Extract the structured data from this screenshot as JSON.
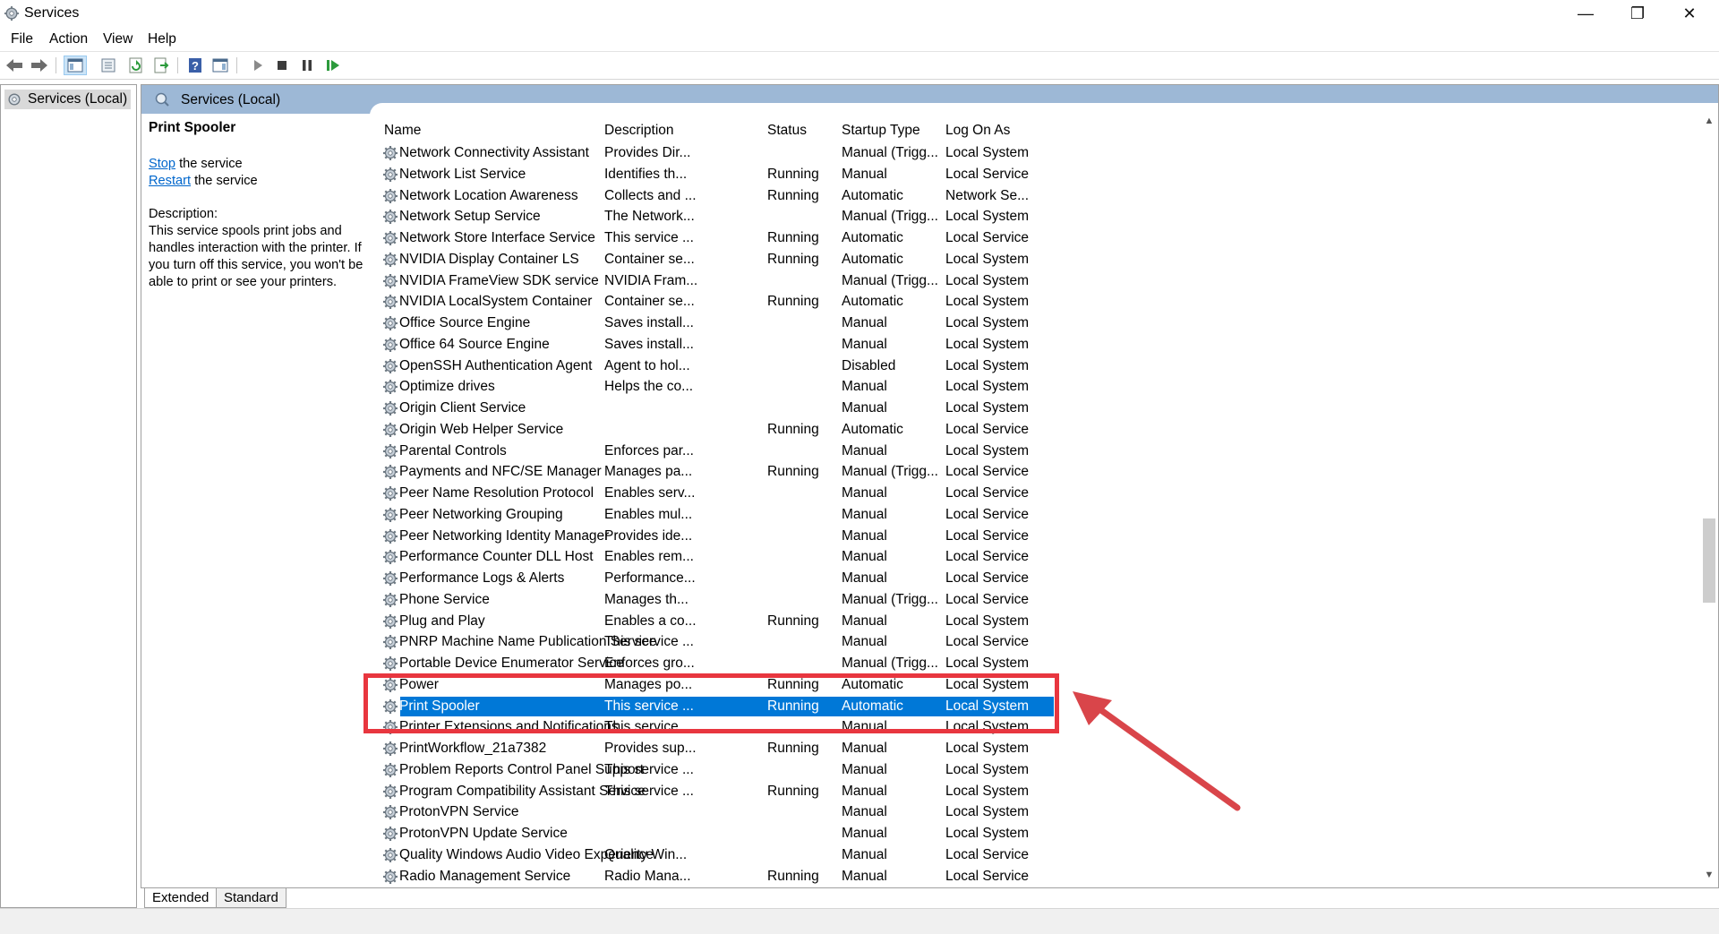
{
  "window": {
    "title": "Services",
    "controls": {
      "minimize": "—",
      "maximize": "❐",
      "close": "✕"
    }
  },
  "menu": [
    "File",
    "Action",
    "View",
    "Help"
  ],
  "toolbar": {
    "icons": [
      "back-icon",
      "forward-icon",
      "show-hide-console-tree-icon",
      "properties-icon",
      "refresh-icon",
      "export-list-icon",
      "help-icon",
      "show-action-pane-icon",
      "start-service-icon",
      "stop-service-icon",
      "pause-service-icon",
      "resume-service-icon"
    ]
  },
  "tree": {
    "root_label": "Services (Local)"
  },
  "panel": {
    "header_title": "Services (Local)"
  },
  "details": {
    "service_name": "Print Spooler",
    "stop_link": "Stop",
    "stop_suffix": " the service",
    "restart_link": "Restart",
    "restart_suffix": " the service",
    "description_label": "Description:",
    "description_text": "This service spools print jobs and handles interaction with the printer. If you turn off this service, you won't be able to print or see your printers."
  },
  "columns": [
    "Name",
    "Description",
    "Status",
    "Startup Type",
    "Log On As"
  ],
  "rows": [
    {
      "name": "Network Connectivity Assistant",
      "description": "Provides Dir...",
      "status": "",
      "startup": "Manual (Trigg...",
      "logon": "Local System"
    },
    {
      "name": "Network List Service",
      "description": "Identifies th...",
      "status": "Running",
      "startup": "Manual",
      "logon": "Local Service"
    },
    {
      "name": "Network Location Awareness",
      "description": "Collects and ...",
      "status": "Running",
      "startup": "Automatic",
      "logon": "Network Se..."
    },
    {
      "name": "Network Setup Service",
      "description": "The Network...",
      "status": "",
      "startup": "Manual (Trigg...",
      "logon": "Local System"
    },
    {
      "name": "Network Store Interface Service",
      "description": "This service ...",
      "status": "Running",
      "startup": "Automatic",
      "logon": "Local Service"
    },
    {
      "name": "NVIDIA Display Container LS",
      "description": "Container se...",
      "status": "Running",
      "startup": "Automatic",
      "logon": "Local System"
    },
    {
      "name": "NVIDIA FrameView SDK service",
      "description": "NVIDIA Fram...",
      "status": "",
      "startup": "Manual (Trigg...",
      "logon": "Local System"
    },
    {
      "name": "NVIDIA LocalSystem Container",
      "description": "Container se...",
      "status": "Running",
      "startup": "Automatic",
      "logon": "Local System"
    },
    {
      "name": "Office  Source Engine",
      "description": "Saves install...",
      "status": "",
      "startup": "Manual",
      "logon": "Local System"
    },
    {
      "name": "Office 64 Source Engine",
      "description": "Saves install...",
      "status": "",
      "startup": "Manual",
      "logon": "Local System"
    },
    {
      "name": "OpenSSH Authentication Agent",
      "description": "Agent to hol...",
      "status": "",
      "startup": "Disabled",
      "logon": "Local System"
    },
    {
      "name": "Optimize drives",
      "description": "Helps the co...",
      "status": "",
      "startup": "Manual",
      "logon": "Local System"
    },
    {
      "name": "Origin Client Service",
      "description": "",
      "status": "",
      "startup": "Manual",
      "logon": "Local System"
    },
    {
      "name": "Origin Web Helper Service",
      "description": "",
      "status": "Running",
      "startup": "Automatic",
      "logon": "Local Service"
    },
    {
      "name": "Parental Controls",
      "description": "Enforces par...",
      "status": "",
      "startup": "Manual",
      "logon": "Local System"
    },
    {
      "name": "Payments and NFC/SE Manager",
      "description": "Manages pa...",
      "status": "Running",
      "startup": "Manual (Trigg...",
      "logon": "Local Service"
    },
    {
      "name": "Peer Name Resolution Protocol",
      "description": "Enables serv...",
      "status": "",
      "startup": "Manual",
      "logon": "Local Service"
    },
    {
      "name": "Peer Networking Grouping",
      "description": "Enables mul...",
      "status": "",
      "startup": "Manual",
      "logon": "Local Service"
    },
    {
      "name": "Peer Networking Identity Manager",
      "description": "Provides ide...",
      "status": "",
      "startup": "Manual",
      "logon": "Local Service"
    },
    {
      "name": "Performance Counter DLL Host",
      "description": "Enables rem...",
      "status": "",
      "startup": "Manual",
      "logon": "Local Service"
    },
    {
      "name": "Performance Logs & Alerts",
      "description": "Performance...",
      "status": "",
      "startup": "Manual",
      "logon": "Local Service"
    },
    {
      "name": "Phone Service",
      "description": "Manages th...",
      "status": "",
      "startup": "Manual (Trigg...",
      "logon": "Local Service"
    },
    {
      "name": "Plug and Play",
      "description": "Enables a co...",
      "status": "Running",
      "startup": "Manual",
      "logon": "Local System"
    },
    {
      "name": "PNRP Machine Name Publication Service",
      "description": "This service ...",
      "status": "",
      "startup": "Manual",
      "logon": "Local Service"
    },
    {
      "name": "Portable Device Enumerator Service",
      "description": "Enforces gro...",
      "status": "",
      "startup": "Manual (Trigg...",
      "logon": "Local System"
    },
    {
      "name": "Power",
      "description": "Manages po...",
      "status": "Running",
      "startup": "Automatic",
      "logon": "Local System"
    },
    {
      "name": "Print Spooler",
      "description": "This service ...",
      "status": "Running",
      "startup": "Automatic",
      "logon": "Local System",
      "selected": true
    },
    {
      "name": "Printer Extensions and Notifications",
      "description": "This service ...",
      "status": "",
      "startup": "Manual",
      "logon": "Local System"
    },
    {
      "name": "PrintWorkflow_21a7382",
      "description": "Provides sup...",
      "status": "Running",
      "startup": "Manual",
      "logon": "Local System"
    },
    {
      "name": "Problem Reports Control Panel Support",
      "description": "This service ...",
      "status": "",
      "startup": "Manual",
      "logon": "Local System"
    },
    {
      "name": "Program Compatibility Assistant Service",
      "description": "This service ...",
      "status": "Running",
      "startup": "Manual",
      "logon": "Local System"
    },
    {
      "name": "ProtonVPN Service",
      "description": "",
      "status": "",
      "startup": "Manual",
      "logon": "Local System"
    },
    {
      "name": "ProtonVPN Update Service",
      "description": "",
      "status": "",
      "startup": "Manual",
      "logon": "Local System"
    },
    {
      "name": "Quality Windows Audio Video Experience",
      "description": "Quality Win...",
      "status": "",
      "startup": "Manual",
      "logon": "Local Service"
    },
    {
      "name": "Radio Management Service",
      "description": "Radio Mana...",
      "status": "Running",
      "startup": "Manual",
      "logon": "Local Service"
    }
  ],
  "tabs": [
    "Extended",
    "Standard"
  ],
  "annotation": {
    "highlight_color": "#e8363f",
    "arrow_color": "#d9454a"
  },
  "colors": {
    "selection": "#0078d7",
    "header_band": "#9db8d6",
    "link": "#0066cc"
  }
}
